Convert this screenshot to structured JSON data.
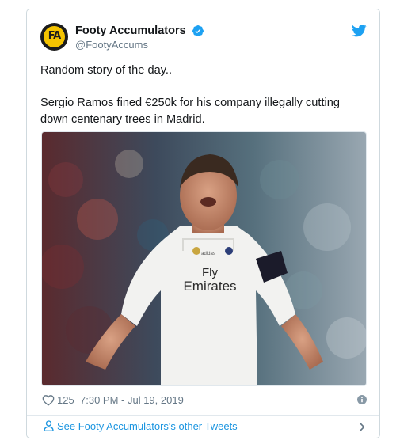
{
  "tweet": {
    "author": {
      "name": "Footy Accumulators",
      "handle": "@FootyAccums",
      "avatar_initials": "FA",
      "verified_icon": "verified-badge-icon"
    },
    "platform_icon": "twitter-bird-icon",
    "lines": [
      "Random story of the day..",
      "Sergio Ramos fined €250k for his company illegally cutting down centenary trees in Madrid."
    ],
    "media": {
      "sponsor_line1": "Fly",
      "sponsor_line2": "Emirates",
      "kit_brand": "adidas"
    },
    "meta": {
      "heart_icon": "heart-icon",
      "likes": "125",
      "timestamp": "7:30 PM - Jul 19, 2019",
      "info_icon": "info-icon"
    },
    "footer": {
      "user_icon": "user-icon",
      "link": "See Footy Accumulators's other Tweets",
      "chevron_icon": "chevron-right-icon"
    }
  },
  "colors": {
    "link_blue": "#1b95e0",
    "twitter_blue": "#1da1f2",
    "text": "#14171a",
    "muted": "#657786",
    "border": "#e1e8ed"
  }
}
